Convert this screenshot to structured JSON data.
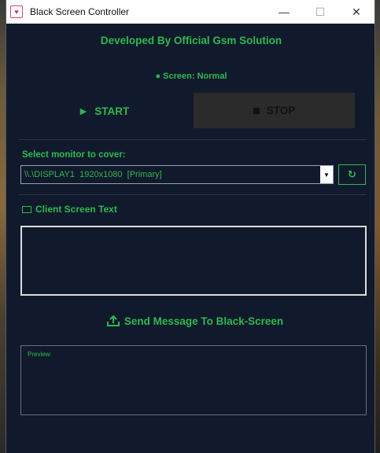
{
  "window": {
    "title": "Black Screen Controller",
    "controls": {
      "minimize": "—",
      "maximize": "☐",
      "close": "✕"
    }
  },
  "header": {
    "developer": "Developed By Official Gsm Solution",
    "status": "● Screen: Normal"
  },
  "actions": {
    "start_label": "START",
    "stop_label": "STOP"
  },
  "monitor": {
    "label": "Select monitor to cover:",
    "selected": "\\\\.\\DISPLAY1  1920x1080  [Primary]",
    "refresh_icon": "refresh-icon"
  },
  "client": {
    "label": "Client Screen Text",
    "text": ""
  },
  "send": {
    "label": "Send Message To Black-Screen"
  },
  "preview": {
    "label": "Preview:"
  },
  "colors": {
    "accent": "#2fb84e",
    "background": "#111a2c",
    "stop_button": "#2b2b2b"
  }
}
